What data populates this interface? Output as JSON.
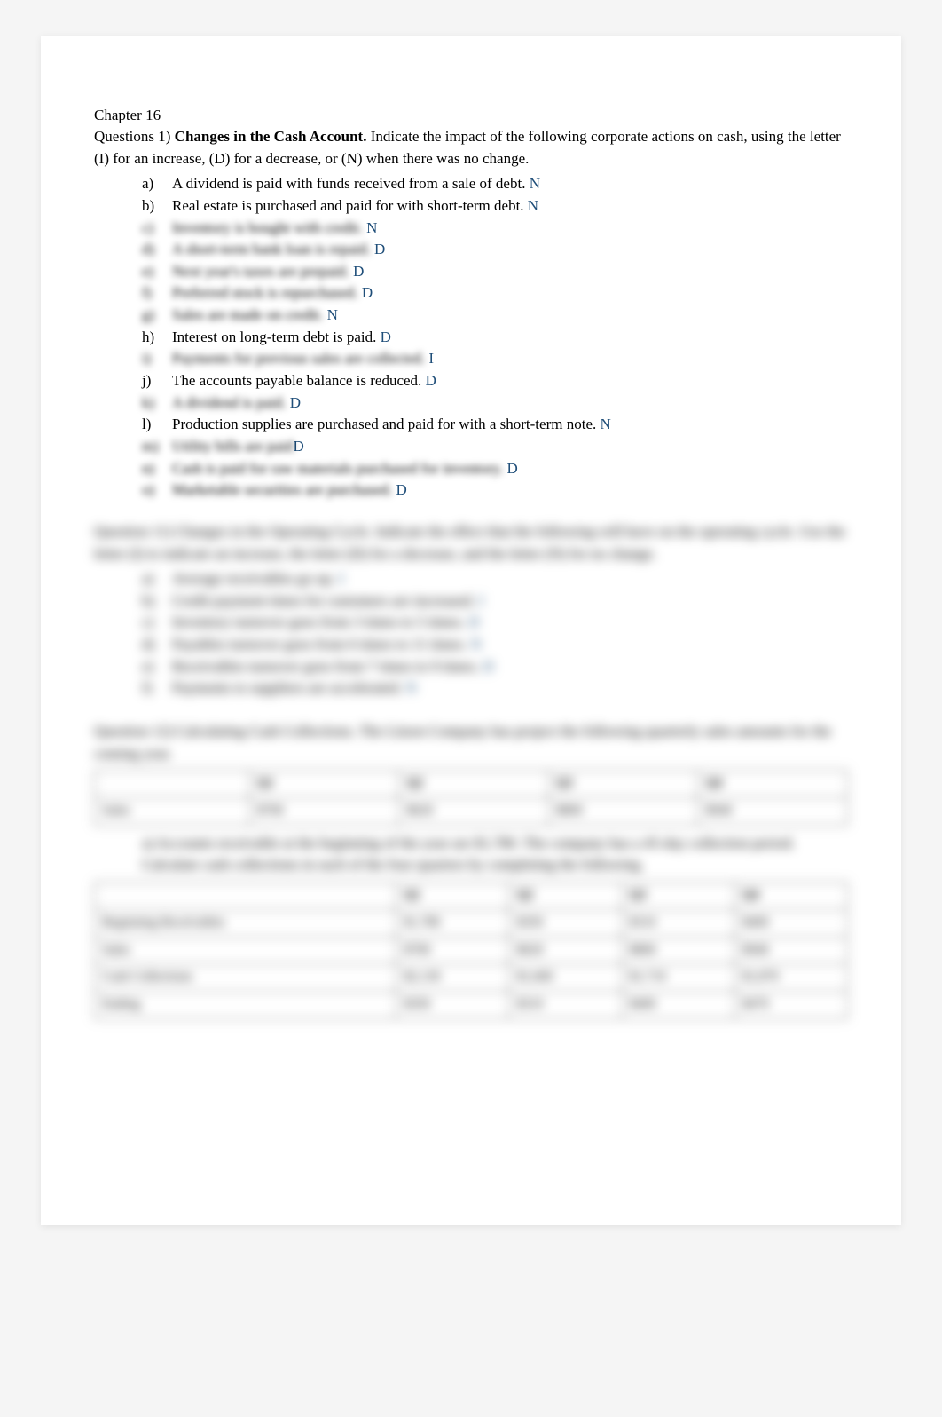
{
  "chapter": "Chapter 16",
  "q1": {
    "lead": "Questions 1) ",
    "title": "Changes in the Cash Account.",
    "rest": "          Indicate the impact of the following corporate actions on cash, using the letter (I) for an increase, (D) for a decrease, or (N) when there was no change.",
    "items": [
      {
        "m": "a)",
        "t": "A dividend is paid with funds received from a sale of debt. ",
        "a": "N",
        "blur": false
      },
      {
        "m": "b)",
        "t": "Real estate is purchased and paid for with short-term debt. ",
        "a": "N",
        "blur": false
      },
      {
        "m": "c)",
        "t": "Inventory is bought with credit.  ",
        "a": "N",
        "blur": true
      },
      {
        "m": "d)",
        "t": "A short-term bank loan is repaid.  ",
        "a": "D",
        "blur": true
      },
      {
        "m": "e)",
        "t": "Next year's taxes are prepaid.  ",
        "a": "D",
        "blur": true
      },
      {
        "m": "f)",
        "t": "Preferred stock is repurchased.  ",
        "a": "D",
        "blur": true
      },
      {
        "m": "g)",
        "t": "Sales are made on credit.  ",
        "a": "N",
        "blur": true
      },
      {
        "m": "h)",
        "t": "Interest on long-term debt is paid. ",
        "a": "D",
        "blur": false
      },
      {
        "m": "i)",
        "t": "Payments for previous sales are collected.  ",
        "a": "I",
        "blur": true
      },
      {
        "m": "j)",
        "t": "The accounts payable balance is reduced. ",
        "a": "D",
        "blur": false
      },
      {
        "m": "k)",
        "t": "A dividend is paid.  ",
        "a": "D",
        "blur": true
      },
      {
        "m": "l)",
        "t": "Production supplies are purchased and paid for with a short-term note. ",
        "a": "N",
        "blur": false
      },
      {
        "m": "m)",
        "t": "Utility bills are paid",
        "a": "D",
        "blur": true
      },
      {
        "m": "n)",
        "t": "Cash is paid for raw materials purchased for inventory. ",
        "a": "D",
        "blur": true
      },
      {
        "m": "o)",
        "t": "Marketable securities are purchased. ",
        "a": "D",
        "blur": true
      }
    ]
  },
  "q11": {
    "lead": "Question 11) Changes in the Operating Cycle.            Indicate the effect that the following will have on the operating cycle. Use the letter (I) to indicate an increase, the letter (D) for a decrease, and the letter (N) for no change.",
    "items": [
      {
        "m": "a)",
        "t": "Average receivables go up. ",
        "a": "I"
      },
      {
        "m": "b)",
        "t": "Credit payment times for customers are increased. ",
        "a": "I"
      },
      {
        "m": "c)",
        "t": "Inventory turnover goes from 3 times to 5 times. ",
        "a": "D"
      },
      {
        "m": "d)",
        "t": "Payables turnover goes from 6 times to 11 times. ",
        "a": "N"
      },
      {
        "m": "e)",
        "t": "Receivables turnover goes from 7 times to 9 times. ",
        "a": "D"
      },
      {
        "m": "f)",
        "t": "Payments to suppliers are accelerated. ",
        "a": "N"
      }
    ]
  },
  "q12": {
    "lead": "Question 12) Calculating Cash Collections.   The Litzen Company has project the following quarterly sales amounts for the coming year.",
    "table1": {
      "headers": [
        "",
        "Q1",
        "Q2",
        "Q3",
        "Q4"
      ],
      "rows": [
        [
          "Sales",
          "$700",
          "$620",
          "$800",
          "$940"
        ]
      ]
    },
    "sub_a": "a)    Accounts receivable at the beginning of the year are $1,780. The company has a 45-day collection period. Calculate cash collections in each of the four quarters by completing the following.",
    "table2": {
      "headers": [
        "",
        "Q1",
        "Q2",
        "Q3",
        "Q4"
      ],
      "rows": [
        [
          "Beginning Receivables",
          "$1,780",
          "$350",
          "$310",
          "$400"
        ],
        [
          "Sales",
          "$700",
          "$620",
          "$800",
          "$940"
        ],
        [
          "Cash Collections",
          "$2,130",
          "$1,660",
          "$1,710",
          "$1,870"
        ],
        [
          "Ending",
          "$350",
          "$310",
          "$400",
          "$470"
        ]
      ]
    }
  }
}
